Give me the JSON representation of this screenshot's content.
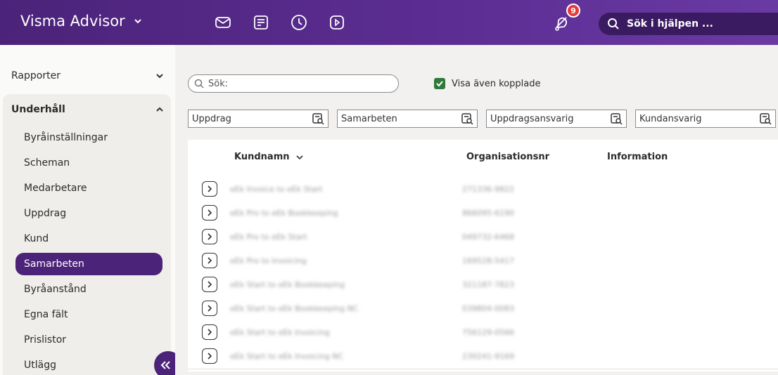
{
  "app": {
    "title": "Visma Advisor",
    "help_search_placeholder": "Sök i hjälpen ...",
    "notification_count": "9"
  },
  "top_icons": [
    "mail-icon",
    "notes-icon",
    "clock-icon",
    "play-icon"
  ],
  "sidebar": {
    "sections": [
      {
        "label": "Rapporter",
        "expanded": false
      },
      {
        "label": "Underhåll",
        "expanded": true
      }
    ],
    "items": [
      "Byråinställningar",
      "Scheman",
      "Medarbetare",
      "Uppdrag",
      "Kund",
      "Samarbeten",
      "Byråanstånd",
      "Egna fält",
      "Prislistor",
      "Utlägg"
    ],
    "active_item": "Samarbeten"
  },
  "main": {
    "search_label": "Sök:",
    "show_linked_label": "Visa även kopplade",
    "show_linked_checked": true,
    "filters": [
      "Uppdrag",
      "Samarbeten",
      "Uppdragsansvarig",
      "Kundansvarig"
    ],
    "table": {
      "headers": [
        "Kundnamn",
        "Organisationsnr",
        "Information"
      ],
      "rows": [
        {
          "name": "eEk Invoice to eEk Start",
          "orgnr": "271336-9822"
        },
        {
          "name": "eEk Pro to eEk Bookkeeping",
          "orgnr": "866095-6190"
        },
        {
          "name": "eEk Pro to eEk Start",
          "orgnr": "049732-6468"
        },
        {
          "name": "eEk Pro to Invoicing",
          "orgnr": "169528-5417"
        },
        {
          "name": "eEk Start to eEk Bookkeeping",
          "orgnr": "321187-7823"
        },
        {
          "name": "eEk Start to eEk Bookkeeping NC",
          "orgnr": "039804-0083"
        },
        {
          "name": "eEk Start to eEk Invoicing",
          "orgnr": "756129-0566"
        },
        {
          "name": "eEk Start to eEk Invoicing NC",
          "orgnr": "230241-9169"
        }
      ]
    }
  },
  "colors": {
    "brand": "#4b2379",
    "check": "#2f7a3a",
    "badge": "#e23b3b"
  }
}
